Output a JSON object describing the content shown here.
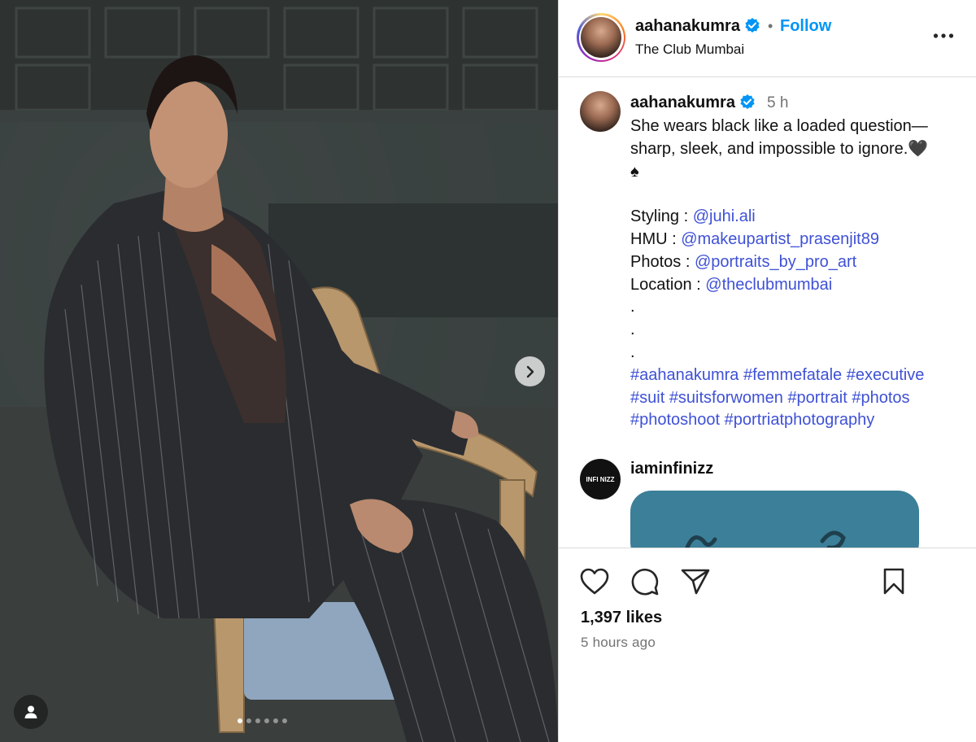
{
  "post": {
    "username": "aahanakumra",
    "follow_label": "Follow",
    "separator": "•",
    "location": "The Club Mumbai",
    "more_icon": "more-horizontal-icon"
  },
  "caption": {
    "username": "aahanakumra",
    "time": "5 h",
    "line1": "She wears black like a loaded question—",
    "line2": "sharp, sleek, and impossible to ignore.",
    "emoji_heart": "🖤",
    "emoji_spade": "♠",
    "credits": [
      {
        "label": "Styling : ",
        "handle": "@juhi.ali"
      },
      {
        "label": "HMU : ",
        "handle": "@makeupartist_prasenjit89"
      },
      {
        "label": "Photos : ",
        "handle": "@portraits_by_pro_art"
      },
      {
        "label": "Location : ",
        "handle": "@theclubmumbai"
      }
    ],
    "dots": [
      ".",
      ".",
      "."
    ],
    "hashtags": [
      "#aahanakumra",
      "#femmefatale",
      "#executive",
      "#suit",
      "#suitsforwomen",
      "#portrait",
      "#photos",
      "#photoshoot",
      "#portriatphotography"
    ]
  },
  "reply": {
    "username": "iaminfinizz",
    "logo_text": "INFI NIZZ"
  },
  "footer": {
    "likes": "1,397 likes",
    "time_ago": "5 hours ago"
  },
  "carousel": {
    "slide_count": 6,
    "active_index": 0
  },
  "colors": {
    "link": "#3f51d6",
    "follow": "#0095f6",
    "muted": "#737373",
    "verified": "#0095f6"
  }
}
